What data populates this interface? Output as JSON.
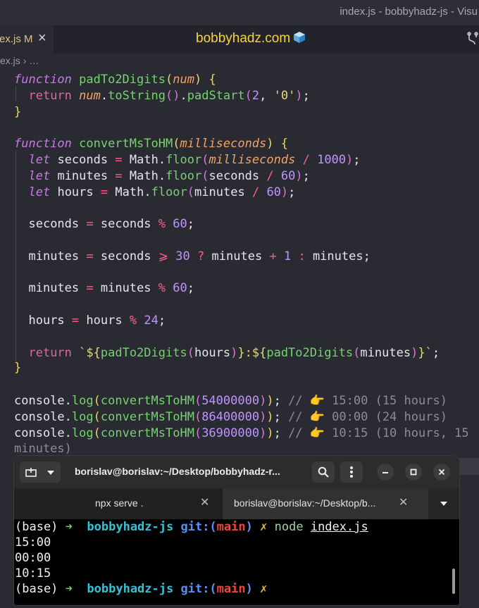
{
  "window": {
    "title": "index.js - bobbyhadz-js - Visu"
  },
  "tab": {
    "name": "ex.js",
    "modified": "M",
    "close": "×"
  },
  "brand": {
    "text": "bobbyhadz.com",
    "icon": "cube-emoji"
  },
  "breadcrumb": {
    "file": "ex.js",
    "sep": "›",
    "rest": "…"
  },
  "code": {
    "kw_function": "function",
    "fn_pad": "padTo2Digits",
    "param_num": "num",
    "kw_return": "return",
    "num_var": "num",
    "to_string": "toString",
    "pad_start": "padStart",
    "two": "2",
    "zero_str": "'0'",
    "fn_convert": "convertMsToHM",
    "param_ms": "milliseconds",
    "kw_let": "let",
    "v_seconds": "seconds",
    "v_minutes": "minutes",
    "v_hours": "hours",
    "math": "Math",
    "floor": "floor",
    "n1000": "1000",
    "n60": "60",
    "n30": "30",
    "n1": "1",
    "n24": "24",
    "op_div": "/",
    "op_mod": "%",
    "op_eq": "=",
    "op_ge": "⩾",
    "op_q": "?",
    "op_plus": "+",
    "op_colon": ":",
    "tmpl_open": "`${",
    "tmpl_mid": "}:${",
    "tmpl_close": "}`",
    "console": "console",
    "log": "log",
    "arg1": "54000000",
    "arg2": "86400000",
    "arg3": "36900000",
    "comment1": "// 👉 15:00 (15 hours)",
    "comment2": "// 👉 00:00 (24 hours)",
    "comment3": "// 👉 10:15 (10 hours, 15",
    "comment3b": "minutes)"
  },
  "terminal": {
    "title": "borislav@borislav:~/Desktop/bobbyhadz-r...",
    "tab1": "npx serve .",
    "tab2": "borislav@borislav:~/Desktop/b...",
    "prompt_base": "(base)",
    "arrow": "➜",
    "dir": "bobbyhadz-js",
    "git": "git:(",
    "branch": "main",
    "git_close": ")",
    "dirty": "✗",
    "cmd": "node",
    "cmd_arg": "index.js",
    "out1": "15:00",
    "out2": "00:00",
    "out3": "10:15",
    "icons": [
      "new-tab-icon",
      "dropdown-icon",
      "search-icon",
      "menu-icon",
      "minimize-icon",
      "maximize-icon",
      "close-icon"
    ]
  }
}
